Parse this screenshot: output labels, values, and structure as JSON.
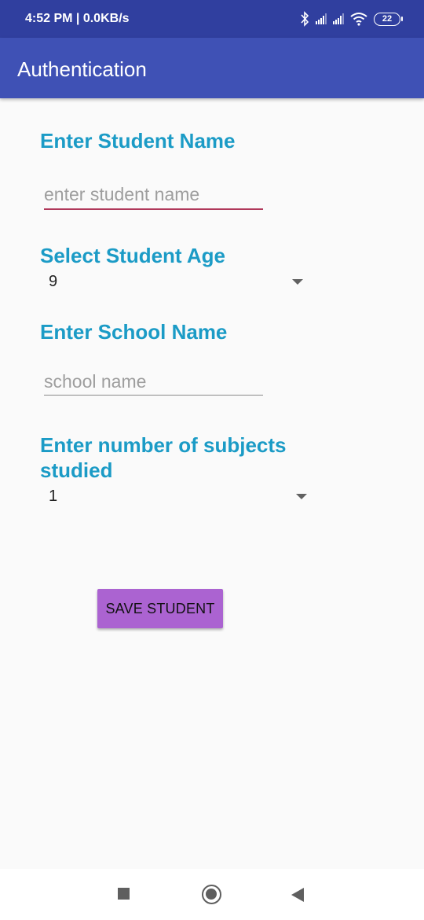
{
  "status_bar": {
    "time": "4:52 PM | 0.0KB/s",
    "battery": "22"
  },
  "app_bar": {
    "title": "Authentication"
  },
  "form": {
    "student_name_label": "Enter Student Name",
    "student_name_placeholder": "enter student name",
    "age_label": "Select Student Age",
    "age_value": "9",
    "school_label": "Enter School Name",
    "school_placeholder": "school name",
    "subjects_label_line1": "Enter number of subjects",
    "subjects_label_line2": "studied",
    "subjects_value": "1",
    "save_label": "SAVE STUDENT"
  },
  "colors": {
    "status_bar": "#303f9f",
    "app_bar": "#3f51b5",
    "label": "#1b9bc6",
    "focused_underline": "#b0385a",
    "button": "#ab63d1"
  },
  "icons": {
    "status": [
      "bluetooth-icon",
      "signal-icon",
      "signal-icon",
      "wifi-icon",
      "battery-icon"
    ],
    "nav": [
      "recent-apps-icon",
      "home-icon",
      "back-icon"
    ],
    "spinner": "dropdown-arrow-icon"
  }
}
